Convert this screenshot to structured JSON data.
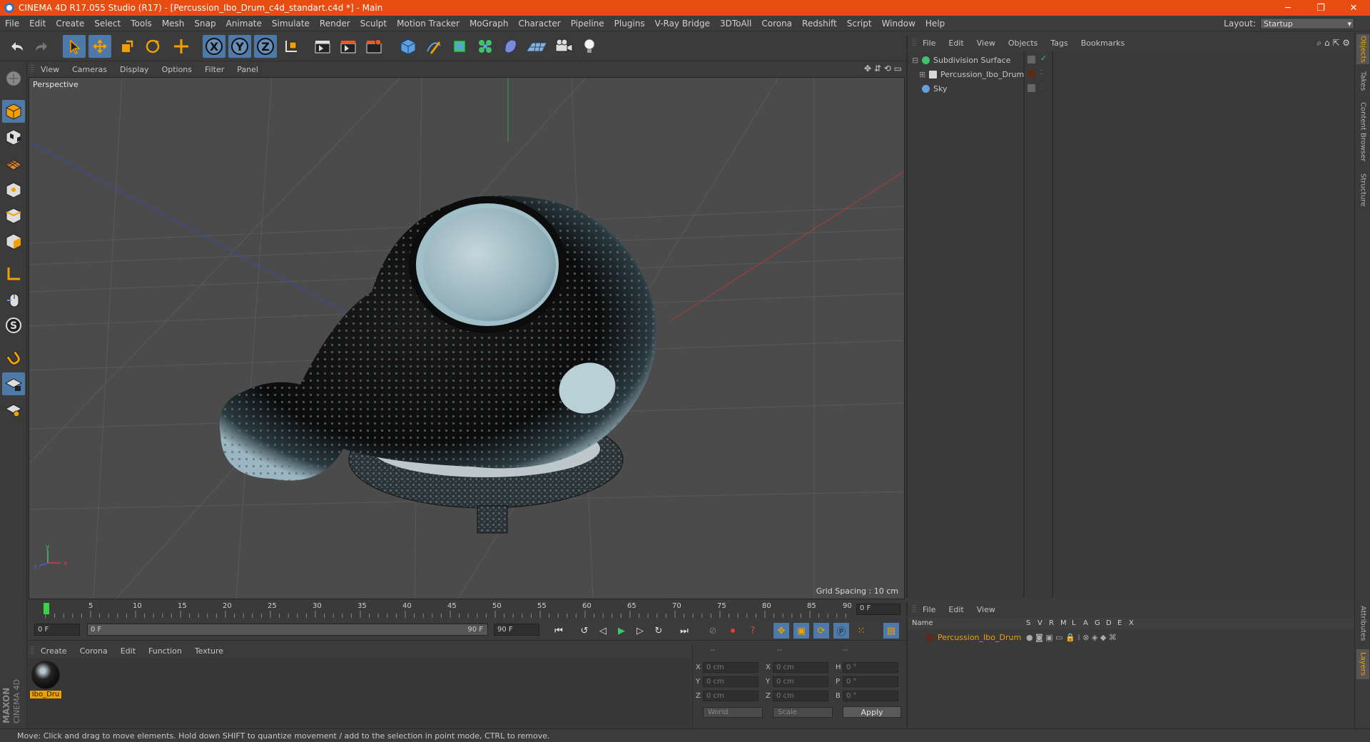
{
  "window": {
    "title": "CINEMA 4D R17.055 Studio (R17) - [Percussion_Ibo_Drum_c4d_standart.c4d *] - Main",
    "controls": [
      "─",
      "❐",
      "✕"
    ]
  },
  "menubar": {
    "items": [
      "File",
      "Edit",
      "Create",
      "Select",
      "Tools",
      "Mesh",
      "Snap",
      "Animate",
      "Simulate",
      "Render",
      "Sculpt",
      "Motion Tracker",
      "MoGraph",
      "Character",
      "Pipeline",
      "Plugins",
      "V-Ray Bridge",
      "3DToAll",
      "Corona",
      "Redshift",
      "Script",
      "Window",
      "Help"
    ],
    "layout_label": "Layout:",
    "layout_value": "Startup"
  },
  "toolbar": {
    "axis_x": "X",
    "axis_y": "Y",
    "axis_z": "Z"
  },
  "viewport": {
    "menu": [
      "View",
      "Cameras",
      "Display",
      "Options",
      "Filter",
      "Panel"
    ],
    "nav_icons": "✥ ⇵ ⟲ ▭",
    "label": "Perspective",
    "grid_spacing": "Grid Spacing : 10 cm",
    "gizmo_y": "y",
    "gizmo_x": "x",
    "gizmo_z": "z"
  },
  "timeline": {
    "ticks": [
      "0",
      "5",
      "10",
      "15",
      "20",
      "25",
      "30",
      "35",
      "40",
      "45",
      "50",
      "55",
      "60",
      "65",
      "70",
      "75",
      "80",
      "85",
      "90"
    ],
    "current_frame": "0 F"
  },
  "transport": {
    "start": "0 F",
    "range_start": "0 F",
    "range_end": "90 F",
    "end": "90 F"
  },
  "material_panel": {
    "menu": [
      "Create",
      "Corona",
      "Edit",
      "Function",
      "Texture"
    ],
    "material_name": "Ibo_Dru"
  },
  "coords": {
    "headers": [
      "--",
      "--",
      "--"
    ],
    "rows": [
      {
        "a": "X",
        "av": "0 cm",
        "b": "X",
        "bv": "0 cm",
        "c": "H",
        "cv": "0 °"
      },
      {
        "a": "Y",
        "av": "0 cm",
        "b": "Y",
        "bv": "0 cm",
        "c": "P",
        "cv": "0 °"
      },
      {
        "a": "Z",
        "av": "0 cm",
        "b": "Z",
        "bv": "0 cm",
        "c": "B",
        "cv": "0 °"
      }
    ],
    "space": "World",
    "mode": "Scale",
    "apply": "Apply"
  },
  "object_manager": {
    "menu": [
      "File",
      "Edit",
      "View",
      "Objects",
      "Tags",
      "Bookmarks"
    ],
    "tools": "⌕ ⌂ ⇱ ⚙",
    "objects": [
      {
        "name": "Subdivision Surface",
        "color": "#3ec46d",
        "check": "✓"
      },
      {
        "name": "Percussion_Ibo_Drum",
        "color": "#d8d8d8",
        "check": ""
      },
      {
        "name": "Sky",
        "color": "#6aa0d8",
        "check": ""
      }
    ]
  },
  "side_tabs": [
    "Objects",
    "Takes",
    "Content Browser",
    "Structure"
  ],
  "side_tabs_bottom": [
    "Attributes",
    "Layers"
  ],
  "layer_manager": {
    "menu": [
      "File",
      "Edit",
      "View"
    ],
    "col_name": "Name",
    "cols": [
      "S",
      "V",
      "R",
      "M",
      "L",
      "A",
      "G",
      "D",
      "E",
      "X"
    ],
    "layer_name": "Percussion_Ibo_Drum"
  },
  "status": {
    "text": "Move: Click and drag to move elements. Hold down SHIFT to quantize movement / add to the selection in point mode, CTRL to remove."
  },
  "brand": {
    "maxon": "MAXON",
    "product": "CINEMA 4D"
  },
  "colors": {
    "title_bar": "#e84c10",
    "accent_blue": "#4d7aa8",
    "highlight_orange": "#f0a000"
  }
}
